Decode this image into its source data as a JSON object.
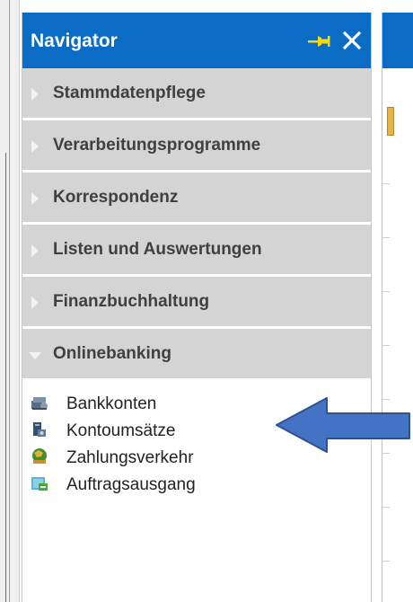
{
  "navigator": {
    "title": "Navigator",
    "sections": [
      {
        "label": "Stammdatenpflege",
        "expanded": false
      },
      {
        "label": "Verarbeitungsprogramme",
        "expanded": false
      },
      {
        "label": "Korrespondenz",
        "expanded": false
      },
      {
        "label": "Listen und Auswertungen",
        "expanded": false
      },
      {
        "label": "Finanzbuchhaltung",
        "expanded": false
      },
      {
        "label": "Onlinebanking",
        "expanded": true
      }
    ],
    "items": [
      {
        "label": "Bankkonten",
        "icon": "bank-accounts-icon"
      },
      {
        "label": "Kontoumsätze",
        "icon": "account-transactions-icon"
      },
      {
        "label": "Zahlungsverkehr",
        "icon": "payments-icon"
      },
      {
        "label": "Auftragsausgang",
        "icon": "order-outbox-icon"
      }
    ]
  },
  "colors": {
    "header": "#0a6cc5",
    "section_bg": "#d4d4d4",
    "arrow": "#4472c4",
    "pin": "#ffd800"
  }
}
